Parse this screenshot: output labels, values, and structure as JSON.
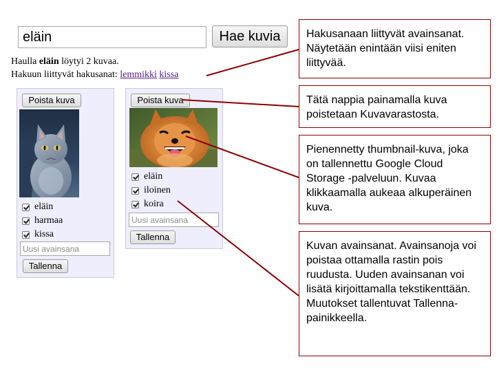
{
  "search": {
    "value": "eläin",
    "button_label": "Hae kuvia"
  },
  "results": {
    "line1_prefix": "Haulla ",
    "term": "eläin",
    "line1_suffix": " löytyi 2 kuvaa.",
    "related_label": "Hakuun liittyvät hakusanat: ",
    "related_terms": [
      "lemmikki",
      "kissa"
    ]
  },
  "cards": [
    {
      "delete_label": "Poista kuva",
      "image": "gray-cat-photo",
      "keywords": [
        {
          "label": "eläin",
          "checked": true
        },
        {
          "label": "harmaa",
          "checked": true
        },
        {
          "label": "kissa",
          "checked": true
        }
      ],
      "new_keyword_placeholder": "Uusi avainsana",
      "save_label": "Tallenna"
    },
    {
      "delete_label": "Poista kuva",
      "image": "happy-dog-photo",
      "keywords": [
        {
          "label": "eläin",
          "checked": true
        },
        {
          "label": "iloinen",
          "checked": true
        },
        {
          "label": "koira",
          "checked": true
        }
      ],
      "new_keyword_placeholder": "Uusi avainsana",
      "save_label": "Tallenna"
    }
  ],
  "callouts": [
    "Hakusanaan liittyvät avainsanat. Näytetään enintään viisi eniten liittyvää.",
    "Tätä nappia painamalla kuva poistetaan Kuvavarastosta.",
    "Pienennetty thumbnail-kuva, joka on tallennettu Google Cloud Storage -palveluun. Kuvaa klikkaamalla aukeaa alkuperäinen kuva.",
    "Kuvan avainsanat. Avainsanoja voi poistaa ottamalla rastin pois ruudusta. Uuden avainsanan voi lisätä kirjoittamalla tekstikenttään. Muutokset tallentuvat Tallenna-painikkeella."
  ],
  "colors": {
    "callout_border": "#8b0000",
    "card_background": "#eeeefc",
    "link": "#551a8b"
  }
}
